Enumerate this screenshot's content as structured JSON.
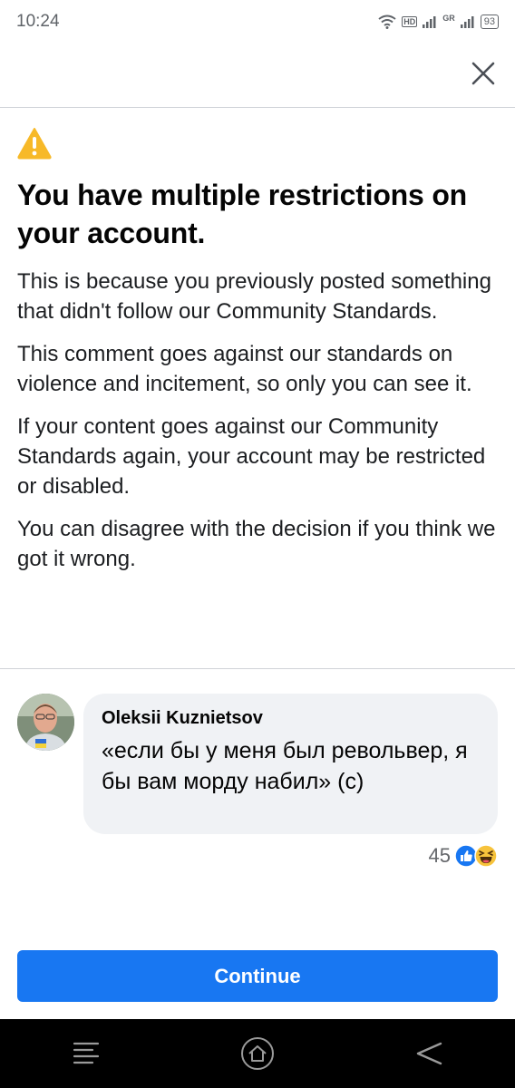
{
  "status_bar": {
    "time": "10:24",
    "network_label": "HD",
    "gr_label": "GR",
    "battery": "93"
  },
  "dialog": {
    "title": "You have multiple restrictions on your account.",
    "paragraphs": [
      "This is because you previously posted something that didn't follow our Community Standards.",
      "This comment goes against our standards on violence and incitement, so only you can see it.",
      "If your content goes against our Community Standards again, your account may be restricted or disabled.",
      "You can disagree with the decision if you think we got it wrong."
    ]
  },
  "comment": {
    "author": "Oleksii Kuznietsov",
    "text": "«если бы у меня был револьвер, я бы вам морду набил» (с)",
    "reaction_count": "45",
    "reactions": [
      "like-icon",
      "haha-icon"
    ]
  },
  "actions": {
    "continue_label": "Continue"
  },
  "colors": {
    "accent": "#1877f2",
    "warning": "#f7b928",
    "bubble": "#f0f2f5"
  }
}
